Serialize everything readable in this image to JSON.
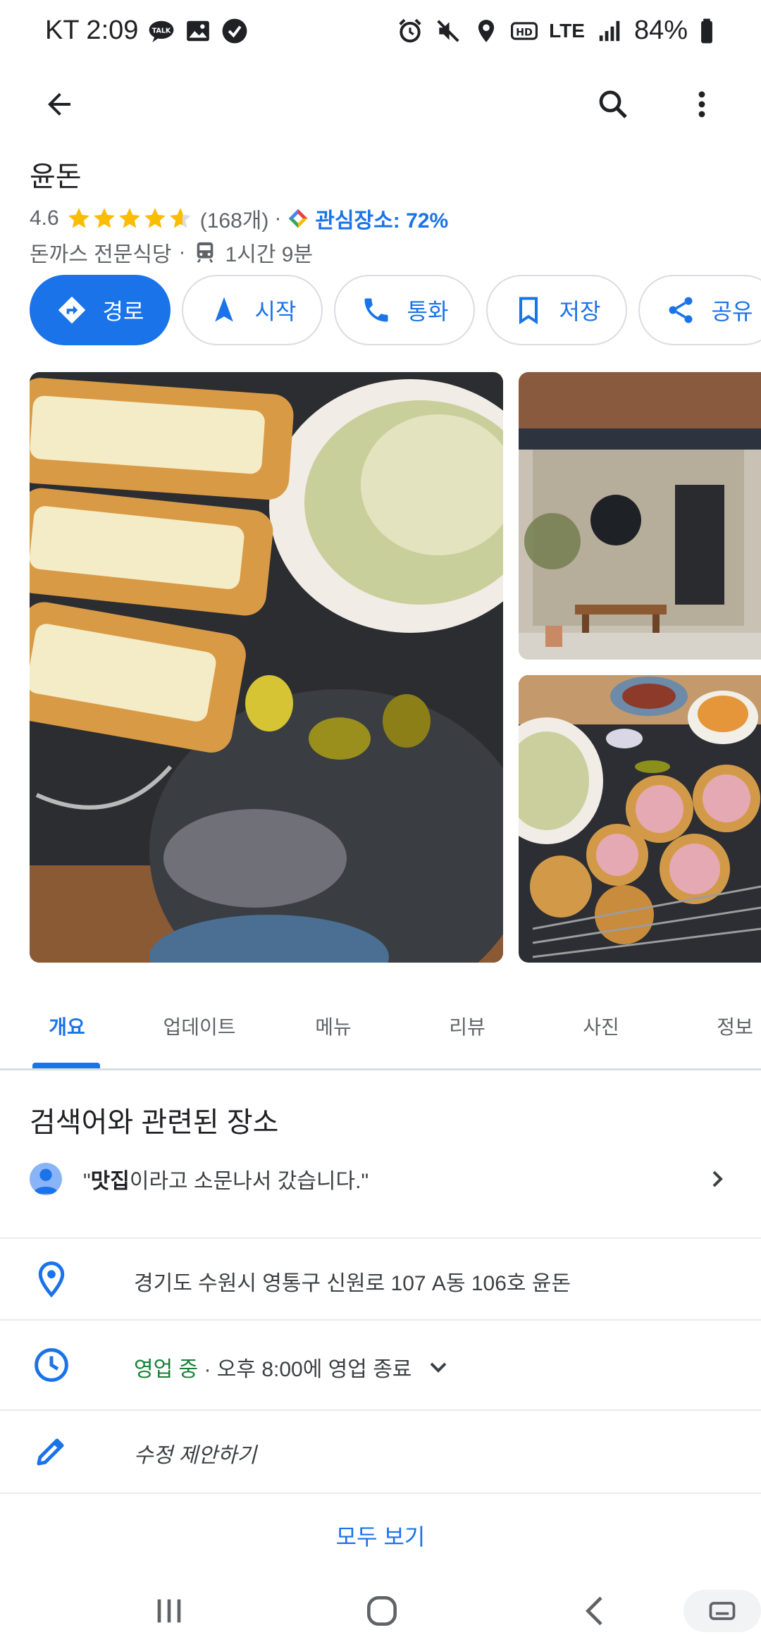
{
  "status_bar": {
    "carrier_time": "KT 2:09",
    "network": "LTE",
    "battery": "84%"
  },
  "place": {
    "name": "윤돈",
    "rating": "4.6",
    "stars_value": 4.6,
    "review_count": "(168개)",
    "separator": "·",
    "saved_label": "관심장소: 72%",
    "category": "돈까스 전문식당",
    "transit_time": "1시간 9분"
  },
  "actions": [
    {
      "label": "경로",
      "icon": "directions-icon"
    },
    {
      "label": "시작",
      "icon": "navigation-icon"
    },
    {
      "label": "통화",
      "icon": "phone-icon"
    },
    {
      "label": "저장",
      "icon": "bookmark-icon"
    },
    {
      "label": "공유",
      "icon": "share-icon"
    }
  ],
  "tabs": [
    "개요",
    "업데이트",
    "메뉴",
    "리뷰",
    "사진",
    "정보"
  ],
  "active_tab": "개요",
  "related": {
    "title": "검색어와 관련된 장소",
    "review_prefix": "\"",
    "review_bold": "맛집",
    "review_rest": "이라고 소문나서 갔습니다.\""
  },
  "info": {
    "address": "경기도 수원시 영통구 신원로 107 A동 106호 윤돈",
    "hours_status": "영업 중",
    "hours_detail": " · 오후 8:00에 영업 종료",
    "suggest_edit": "수정 제안하기"
  },
  "see_all": "모두 보기",
  "colors": {
    "accent": "#1a73e8",
    "open": "#188038",
    "star": "#fbbc04"
  }
}
